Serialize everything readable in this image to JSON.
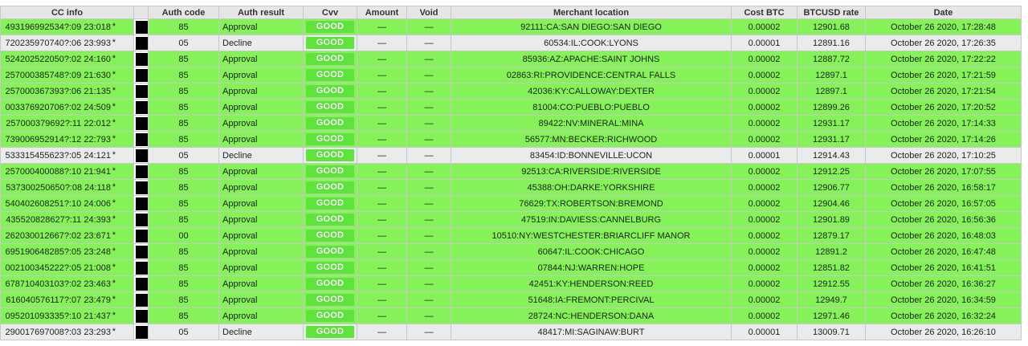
{
  "table": {
    "headers": [
      "CC info",
      "Auth code",
      "Auth result",
      "Cvv",
      "Amount",
      "Void",
      "Merchant location",
      "Cost BTC",
      "BTCUSD rate",
      "Date"
    ],
    "rows": [
      {
        "cc": "493196992534?:09 23:018",
        "auth_code": "85",
        "auth_result": "Approval",
        "cvv": "GOOD",
        "amount": "—",
        "void": "—",
        "merchant": "92111:CA:SAN DIEGO:SAN DIEGO",
        "cost": "0.00002",
        "rate": "12901.68",
        "date": "October 26 2020, 17:28:48"
      },
      {
        "cc": "720235970740?:06 23:993",
        "auth_code": "05",
        "auth_result": "Decline",
        "cvv": "GOOD",
        "amount": "—",
        "void": "—",
        "merchant": "60534:IL:COOK:LYONS",
        "cost": "0.00001",
        "rate": "12891.16",
        "date": "October 26 2020, 17:26:35"
      },
      {
        "cc": "524202522050?:02 24:160",
        "auth_code": "85",
        "auth_result": "Approval",
        "cvv": "GOOD",
        "amount": "—",
        "void": "—",
        "merchant": "85936:AZ:APACHE:SAINT JOHNS",
        "cost": "0.00002",
        "rate": "12887.72",
        "date": "October 26 2020, 17:22:22"
      },
      {
        "cc": "257000385748?:09 21:630",
        "auth_code": "85",
        "auth_result": "Approval",
        "cvv": "GOOD",
        "amount": "—",
        "void": "—",
        "merchant": "02863:RI:PROVIDENCE:CENTRAL FALLS",
        "cost": "0.00002",
        "rate": "12897.1",
        "date": "October 26 2020, 17:21:59"
      },
      {
        "cc": "257000367393?:06 21:135",
        "auth_code": "85",
        "auth_result": "Approval",
        "cvv": "GOOD",
        "amount": "—",
        "void": "—",
        "merchant": "42036:KY:CALLOWAY:DEXTER",
        "cost": "0.00002",
        "rate": "12897.1",
        "date": "October 26 2020, 17:21:54"
      },
      {
        "cc": "003376920706?:02 24:509",
        "auth_code": "85",
        "auth_result": "Approval",
        "cvv": "GOOD",
        "amount": "—",
        "void": "—",
        "merchant": "81004:CO:PUEBLO:PUEBLO",
        "cost": "0.00002",
        "rate": "12899.26",
        "date": "October 26 2020, 17:20:52"
      },
      {
        "cc": "257000379692?:11 22:012",
        "auth_code": "85",
        "auth_result": "Approval",
        "cvv": "GOOD",
        "amount": "—",
        "void": "—",
        "merchant": "89422:NV:MINERAL:MINA",
        "cost": "0.00002",
        "rate": "12931.17",
        "date": "October 26 2020, 17:14:33"
      },
      {
        "cc": "739006952914?:12 22:793",
        "auth_code": "85",
        "auth_result": "Approval",
        "cvv": "GOOD",
        "amount": "—",
        "void": "—",
        "merchant": "56577:MN:BECKER:RICHWOOD",
        "cost": "0.00002",
        "rate": "12931.17",
        "date": "October 26 2020, 17:14:26"
      },
      {
        "cc": "533315455623?:05 24:121",
        "auth_code": "05",
        "auth_result": "Decline",
        "cvv": "GOOD",
        "amount": "—",
        "void": "—",
        "merchant": "83454:ID:BONNEVILLE:UCON",
        "cost": "0.00001",
        "rate": "12914.43",
        "date": "October 26 2020, 17:10:25"
      },
      {
        "cc": "257000400088?:10 21:941",
        "auth_code": "85",
        "auth_result": "Approval",
        "cvv": "GOOD",
        "amount": "—",
        "void": "—",
        "merchant": "92513:CA:RIVERSIDE:RIVERSIDE",
        "cost": "0.00002",
        "rate": "12912.25",
        "date": "October 26 2020, 17:07:55"
      },
      {
        "cc": "537300250650?:08 24:118",
        "auth_code": "85",
        "auth_result": "Approval",
        "cvv": "GOOD",
        "amount": "—",
        "void": "—",
        "merchant": "45388:OH:DARKE:YORKSHIRE",
        "cost": "0.00002",
        "rate": "12906.77",
        "date": "October 26 2020, 16:58:17"
      },
      {
        "cc": "540402608251?:10 24:006",
        "auth_code": "85",
        "auth_result": "Approval",
        "cvv": "GOOD",
        "amount": "—",
        "void": "—",
        "merchant": "76629:TX:ROBERTSON:BREMOND",
        "cost": "0.00002",
        "rate": "12904.46",
        "date": "October 26 2020, 16:57:05"
      },
      {
        "cc": "435520828627?:11 24:393",
        "auth_code": "85",
        "auth_result": "Approval",
        "cvv": "GOOD",
        "amount": "—",
        "void": "—",
        "merchant": "47519:IN:DAVIESS:CANNELBURG",
        "cost": "0.00002",
        "rate": "12901.89",
        "date": "October 26 2020, 16:56:36"
      },
      {
        "cc": "262030012667?:02 23:671",
        "auth_code": "00",
        "auth_result": "Approval",
        "cvv": "GOOD",
        "amount": "—",
        "void": "—",
        "merchant": "10510:NY:WESTCHESTER:BRIARCLIFF MANOR",
        "cost": "0.00002",
        "rate": "12879.17",
        "date": "October 26 2020, 16:48:03"
      },
      {
        "cc": "695190648285?:05 23:248",
        "auth_code": "85",
        "auth_result": "Approval",
        "cvv": "GOOD",
        "amount": "—",
        "void": "—",
        "merchant": "60647:IL:COOK:CHICAGO",
        "cost": "0.00002",
        "rate": "12891.2",
        "date": "October 26 2020, 16:47:48"
      },
      {
        "cc": "002100345222?:05 21:008",
        "auth_code": "85",
        "auth_result": "Approval",
        "cvv": "GOOD",
        "amount": "—",
        "void": "—",
        "merchant": "07844:NJ:WARREN:HOPE",
        "cost": "0.00002",
        "rate": "12851.82",
        "date": "October 26 2020, 16:41:51"
      },
      {
        "cc": "678710403103?:02 23:463",
        "auth_code": "85",
        "auth_result": "Approval",
        "cvv": "GOOD",
        "amount": "—",
        "void": "—",
        "merchant": "42451:KY:HENDERSON:REED",
        "cost": "0.00002",
        "rate": "12912.55",
        "date": "October 26 2020, 16:36:27"
      },
      {
        "cc": "616040576117?:07 23:479",
        "auth_code": "85",
        "auth_result": "Approval",
        "cvv": "GOOD",
        "amount": "—",
        "void": "—",
        "merchant": "51648:IA:FREMONT:PERCIVAL",
        "cost": "0.00002",
        "rate": "12949.7",
        "date": "October 26 2020, 16:34:59"
      },
      {
        "cc": "095201093335?:10 21:437",
        "auth_code": "85",
        "auth_result": "Approval",
        "cvv": "GOOD",
        "amount": "—",
        "void": "—",
        "merchant": "28724:NC:HENDERSON:DANA",
        "cost": "0.00002",
        "rate": "12971.46",
        "date": "October 26 2020, 16:32:24"
      },
      {
        "cc": "290017697008?:03 23:293",
        "auth_code": "05",
        "auth_result": "Decline",
        "cvv": "GOOD",
        "amount": "—",
        "void": "—",
        "merchant": "48417:MI:SAGINAW:BURT",
        "cost": "0.00001",
        "rate": "13009.71",
        "date": "October 26 2020, 16:26:10"
      }
    ]
  }
}
